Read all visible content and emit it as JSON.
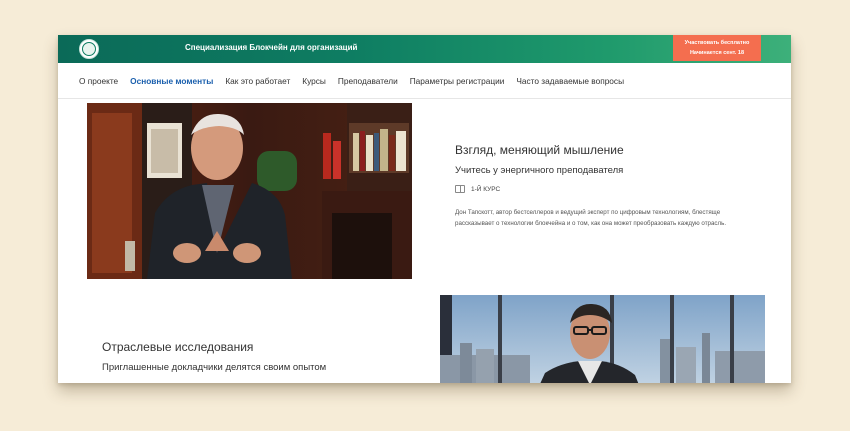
{
  "header": {
    "title": "Специализация Блокчейн для организаций",
    "enroll_line1": "Участвовать бесплатно",
    "enroll_line2": "Начинается сент. 18",
    "logo_icon": "university-logo-icon"
  },
  "nav": {
    "items": [
      {
        "label": "О проекте",
        "active": false
      },
      {
        "label": "Основные моменты",
        "active": true
      },
      {
        "label": "Как это работает",
        "active": false
      },
      {
        "label": "Курсы",
        "active": false
      },
      {
        "label": "Преподаватели",
        "active": false
      },
      {
        "label": "Параметры регистрации",
        "active": false
      },
      {
        "label": "Часто задаваемые вопросы",
        "active": false
      }
    ]
  },
  "section1": {
    "heading": "Взгляд, меняющий мышление",
    "subheading": "Учитесь у энергичного преподавателя",
    "badge_icon": "book-icon",
    "badge": "1-Й КУРС",
    "description": "Дон Тапскотт, автор бестселлеров и ведущий эксперт по цифровым технологиям, блестяще рассказывает о технологии блокчейна и о том, как она может преобразовать каждую отрасль."
  },
  "section2": {
    "heading": "Отраслевые исследования",
    "subheading": "Приглашенные докладчики делятся своим опытом"
  },
  "colors": {
    "accent": "#1a5fad",
    "enroll": "#f46e4f",
    "header_start": "#0b6a58",
    "header_end": "#3db07a",
    "page_background": "#f6ecd7"
  }
}
